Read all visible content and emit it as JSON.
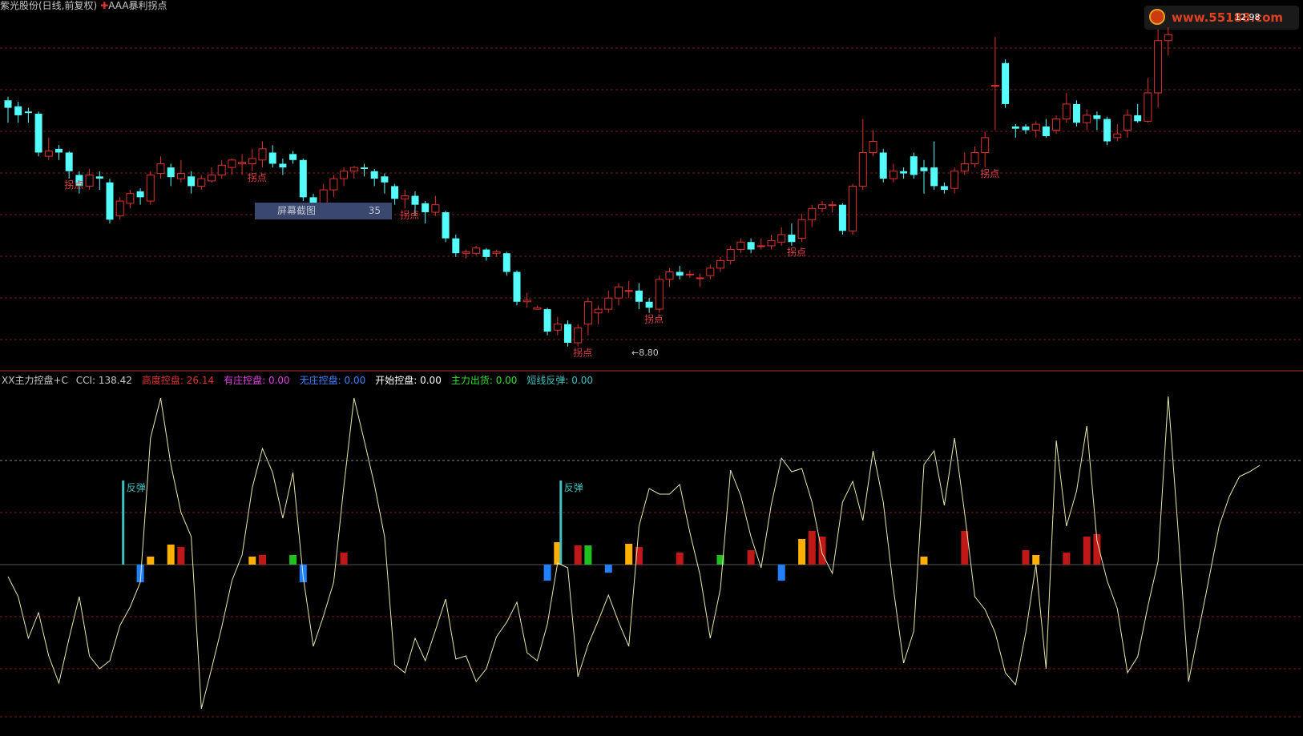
{
  "header": {
    "title": "紫光股份(日线,前复权)",
    "indicator": "AAA暴利拐点",
    "price_high": "12.98",
    "price_low": "8.80"
  },
  "watermark": {
    "text": "www.55188.com"
  },
  "tooltip": {
    "label": "屏幕截图",
    "value": "35"
  },
  "sub_header": {
    "name": "XX主力控盘+C",
    "items": [
      {
        "label": "CCI",
        "value": "138.42",
        "color": "#c8c8c8"
      },
      {
        "label": "高度控盘",
        "value": "26.14",
        "color": "#e03030"
      },
      {
        "label": "有庄控盘",
        "value": "0.00",
        "color": "#e040e0"
      },
      {
        "label": "无庄控盘",
        "value": "0.00",
        "color": "#4080ff"
      },
      {
        "label": "开始控盘",
        "value": "0.00",
        "color": "#ffffff"
      },
      {
        "label": "主力出货",
        "value": "0.00",
        "color": "#30e030"
      },
      {
        "label": "短线反弹",
        "value": "0.00",
        "color": "#40c0c0"
      }
    ]
  },
  "colors": {
    "up": "#e03030",
    "down": "#54fcfc",
    "cci_line": "#e8e8b0",
    "red_bar": "#c01818",
    "orange_bar": "#ffb000",
    "green_bar": "#20c020",
    "blue_bar": "#2080ff",
    "rebound": "#40c0c0",
    "grid": "#7a2020"
  },
  "chart_data": [
    {
      "type": "candlestick",
      "title": "紫光股份(日线,前复权)",
      "y_high_label": "12.98",
      "y_low_label": "8.80",
      "candles": [
        [
          12.0,
          11.9,
          12.05,
          11.7
        ],
        [
          11.92,
          11.8,
          11.98,
          11.7
        ],
        [
          11.85,
          11.83,
          11.9,
          11.7
        ],
        [
          11.82,
          11.3,
          11.85,
          11.25
        ],
        [
          11.25,
          11.32,
          11.5,
          11.2
        ],
        [
          11.35,
          11.3,
          11.4,
          11.2
        ],
        [
          11.3,
          11.05,
          11.32,
          10.95
        ],
        [
          11.0,
          10.85,
          11.05,
          10.75
        ],
        [
          10.85,
          11.0,
          11.08,
          10.8
        ],
        [
          10.98,
          10.95,
          11.05,
          10.8
        ],
        [
          10.9,
          10.4,
          10.95,
          10.35
        ],
        [
          10.45,
          10.65,
          10.7,
          10.4
        ],
        [
          10.62,
          10.75,
          10.8,
          10.55
        ],
        [
          10.78,
          10.7,
          10.82,
          10.6
        ],
        [
          10.65,
          11.0,
          11.05,
          10.6
        ],
        [
          11.02,
          11.15,
          11.25,
          10.95
        ],
        [
          11.1,
          10.97,
          11.15,
          10.85
        ],
        [
          10.95,
          11.02,
          11.2,
          10.9
        ],
        [
          10.98,
          10.85,
          11.05,
          10.75
        ],
        [
          10.85,
          10.95,
          11.0,
          10.8
        ],
        [
          10.92,
          11.0,
          11.1,
          10.9
        ],
        [
          11.0,
          11.13,
          11.2,
          10.95
        ],
        [
          11.1,
          11.2,
          11.22,
          11.0
        ],
        [
          11.15,
          11.17,
          11.28,
          11.0
        ],
        [
          11.15,
          11.22,
          11.35,
          11.05
        ],
        [
          11.2,
          11.35,
          11.45,
          11.1
        ],
        [
          11.3,
          11.15,
          11.4,
          11.1
        ],
        [
          11.15,
          11.1,
          11.22,
          11.0
        ],
        [
          11.28,
          11.2,
          11.32,
          11.15
        ],
        [
          11.2,
          10.7,
          11.22,
          10.65
        ],
        [
          10.7,
          10.62,
          10.75,
          10.55
        ],
        [
          10.62,
          10.8,
          10.88,
          10.55
        ],
        [
          10.8,
          10.95,
          11.0,
          10.7
        ],
        [
          10.95,
          11.05,
          11.1,
          10.85
        ],
        [
          11.05,
          11.1,
          11.12,
          10.95
        ],
        [
          11.1,
          11.08,
          11.15,
          10.98
        ],
        [
          11.05,
          10.95,
          11.08,
          10.85
        ],
        [
          10.98,
          10.9,
          11.02,
          10.75
        ],
        [
          10.85,
          10.68,
          10.88,
          10.6
        ],
        [
          10.68,
          10.72,
          10.8,
          10.55
        ],
        [
          10.72,
          10.6,
          10.78,
          10.45
        ],
        [
          10.62,
          10.5,
          10.65,
          10.35
        ],
        [
          10.5,
          10.6,
          10.72,
          10.45
        ],
        [
          10.5,
          10.15,
          10.52,
          10.1
        ],
        [
          10.15,
          9.95,
          10.2,
          9.9
        ],
        [
          9.95,
          9.97,
          10.0,
          9.88
        ],
        [
          9.95,
          10.02,
          10.05,
          9.92
        ],
        [
          10.0,
          9.9,
          10.02,
          9.85
        ],
        [
          9.95,
          9.97,
          10.0,
          9.9
        ],
        [
          9.95,
          9.7,
          9.97,
          9.65
        ],
        [
          9.7,
          9.3,
          9.72,
          9.25
        ],
        [
          9.3,
          9.32,
          9.42,
          9.22
        ],
        [
          9.2,
          9.22,
          9.25,
          9.2
        ],
        [
          9.2,
          8.9,
          9.22,
          8.85
        ],
        [
          8.92,
          9.0,
          9.1,
          8.85
        ],
        [
          9.0,
          8.75,
          9.05,
          8.7
        ],
        [
          8.75,
          8.95,
          9.0,
          8.7
        ],
        [
          9.0,
          9.3,
          9.35,
          8.85
        ],
        [
          9.15,
          9.2,
          9.25,
          9.0
        ],
        [
          9.2,
          9.35,
          9.45,
          9.15
        ],
        [
          9.35,
          9.5,
          9.55,
          9.25
        ],
        [
          9.45,
          9.45,
          9.58,
          9.35
        ],
        [
          9.45,
          9.3,
          9.55,
          9.2
        ],
        [
          9.3,
          9.22,
          9.35,
          9.15
        ],
        [
          9.2,
          9.6,
          9.65,
          9.15
        ],
        [
          9.6,
          9.7,
          9.75,
          9.5
        ],
        [
          9.7,
          9.65,
          9.78,
          9.6
        ],
        [
          9.67,
          9.67,
          9.72,
          9.62
        ],
        [
          9.62,
          9.62,
          9.68,
          9.5
        ],
        [
          9.65,
          9.75,
          9.8,
          9.6
        ],
        [
          9.75,
          9.85,
          9.9,
          9.7
        ],
        [
          9.85,
          10.0,
          10.05,
          9.8
        ],
        [
          10.0,
          10.1,
          10.15,
          9.95
        ],
        [
          10.1,
          10.0,
          10.15,
          9.95
        ],
        [
          10.05,
          10.05,
          10.15,
          10.0
        ],
        [
          10.05,
          10.12,
          10.2,
          10.0
        ],
        [
          10.1,
          10.2,
          10.3,
          10.05
        ],
        [
          10.2,
          10.1,
          10.35,
          10.05
        ],
        [
          10.15,
          10.4,
          10.48,
          10.1
        ],
        [
          10.4,
          10.55,
          10.6,
          10.3
        ],
        [
          10.55,
          10.6,
          10.65,
          10.5
        ],
        [
          10.6,
          10.6,
          10.65,
          10.5
        ],
        [
          10.6,
          10.25,
          10.62,
          10.2
        ],
        [
          10.25,
          10.85,
          10.88,
          10.2
        ],
        [
          10.85,
          11.3,
          11.75,
          10.8
        ],
        [
          11.3,
          11.45,
          11.6,
          11.25
        ],
        [
          11.3,
          10.95,
          11.35,
          10.9
        ],
        [
          10.95,
          11.05,
          11.15,
          10.9
        ],
        [
          11.05,
          11.02,
          11.1,
          10.95
        ],
        [
          11.25,
          11.0,
          11.3,
          10.95
        ],
        [
          11.1,
          11.05,
          11.2,
          10.75
        ],
        [
          11.1,
          10.85,
          11.45,
          10.8
        ],
        [
          10.85,
          10.8,
          10.9,
          10.75
        ],
        [
          10.82,
          11.05,
          11.1,
          10.75
        ],
        [
          11.05,
          11.15,
          11.3,
          11.0
        ],
        [
          11.15,
          11.3,
          11.38,
          11.1
        ],
        [
          11.3,
          11.5,
          11.58,
          11.1
        ],
        [
          12.2,
          12.2,
          12.85,
          11.6
        ],
        [
          12.5,
          11.95,
          12.55,
          11.9
        ],
        [
          11.65,
          11.62,
          11.68,
          11.5
        ],
        [
          11.65,
          11.6,
          11.68,
          11.55
        ],
        [
          11.6,
          11.68,
          11.72,
          11.5
        ],
        [
          11.65,
          11.52,
          11.75,
          11.5
        ],
        [
          11.6,
          11.75,
          11.8,
          11.55
        ],
        [
          11.75,
          11.95,
          12.1,
          11.7
        ],
        [
          11.95,
          11.7,
          12.0,
          11.65
        ],
        [
          11.7,
          11.8,
          11.88,
          11.6
        ],
        [
          11.8,
          11.75,
          11.85,
          11.6
        ],
        [
          11.75,
          11.45,
          11.78,
          11.4
        ],
        [
          11.5,
          11.55,
          11.68,
          11.45
        ],
        [
          11.6,
          11.8,
          11.88,
          11.5
        ],
        [
          11.8,
          11.72,
          11.95,
          11.7
        ],
        [
          11.72,
          12.1,
          12.3,
          11.7
        ],
        [
          12.1,
          12.8,
          12.95,
          11.9
        ],
        [
          12.8,
          12.88,
          12.98,
          12.6
        ]
      ],
      "turning_points": [
        {
          "index": 6,
          "label": "拐点"
        },
        {
          "index": 24,
          "label": "拐点"
        },
        {
          "index": 29,
          "label": "拐点"
        },
        {
          "index": 30,
          "label": "拐点"
        },
        {
          "index": 39,
          "label": "拐点"
        },
        {
          "index": 56,
          "label": "拐点"
        },
        {
          "index": 63,
          "label": "拐点"
        },
        {
          "index": 77,
          "label": "拐点"
        },
        {
          "index": 96,
          "label": "拐点"
        }
      ]
    },
    {
      "type": "combo",
      "title": "XX主力控盘+C",
      "cci_line": [
        -15,
        -40,
        -92,
        -60,
        -114,
        -148,
        -92,
        -40,
        -114,
        -130,
        -120,
        -76,
        -53,
        -22,
        158,
        208,
        125,
        65,
        35,
        -180,
        -130,
        -78,
        -20,
        12,
        96,
        145,
        115,
        58,
        115,
        -15,
        -102,
        -64,
        -22,
        98,
        208,
        155,
        100,
        35,
        -125,
        -135,
        -92,
        -120,
        -82,
        -43,
        -118,
        -114,
        -146,
        -130,
        -90,
        -72,
        -47,
        -110,
        -120,
        -74,
        2,
        -4,
        -140,
        -100,
        -70,
        -38,
        -72,
        -102,
        48,
        95,
        88,
        88,
        100,
        40,
        -13,
        -92,
        -30,
        118,
        86,
        35,
        -4,
        75,
        133,
        116,
        120,
        78,
        14,
        -11,
        78,
        104,
        55,
        142,
        78,
        -30,
        -123,
        -83,
        125,
        142,
        74,
        158,
        64,
        -40,
        -56,
        -85,
        -135,
        -150,
        -85,
        0,
        -130,
        155,
        48,
        92,
        173,
        30,
        -20,
        -55,
        -135,
        -115,
        -52,
        4,
        210,
        38,
        -146,
        -82,
        -18,
        48,
        85,
        110,
        116,
        124
      ],
      "bars": [
        {
          "index": 13,
          "value": -22,
          "color": "blue"
        },
        {
          "index": 14,
          "value": 10,
          "color": "orange"
        },
        {
          "index": 16,
          "value": 25,
          "color": "orange"
        },
        {
          "index": 17,
          "value": 22,
          "color": "red"
        },
        {
          "index": 24,
          "value": 10,
          "color": "orange"
        },
        {
          "index": 25,
          "value": 12,
          "color": "red"
        },
        {
          "index": 28,
          "value": 12,
          "color": "green"
        },
        {
          "index": 29,
          "value": -22,
          "color": "blue"
        },
        {
          "index": 33,
          "value": 15,
          "color": "red"
        },
        {
          "index": 53,
          "value": -20,
          "color": "blue"
        },
        {
          "index": 54,
          "value": 28,
          "color": "orange"
        },
        {
          "index": 56,
          "value": 24,
          "color": "red"
        },
        {
          "index": 57,
          "value": 24,
          "color": "green"
        },
        {
          "index": 59,
          "value": -10,
          "color": "blue"
        },
        {
          "index": 61,
          "value": 26,
          "color": "orange"
        },
        {
          "index": 62,
          "value": 22,
          "color": "red"
        },
        {
          "index": 66,
          "value": 15,
          "color": "red"
        },
        {
          "index": 70,
          "value": 12,
          "color": "green"
        },
        {
          "index": 73,
          "value": 18,
          "color": "red"
        },
        {
          "index": 76,
          "value": -20,
          "color": "blue"
        },
        {
          "index": 78,
          "value": 32,
          "color": "orange"
        },
        {
          "index": 79,
          "value": 42,
          "color": "red"
        },
        {
          "index": 80,
          "value": 35,
          "color": "red"
        },
        {
          "index": 90,
          "value": 10,
          "color": "orange"
        },
        {
          "index": 94,
          "value": 42,
          "color": "red"
        },
        {
          "index": 100,
          "value": 18,
          "color": "red"
        },
        {
          "index": 101,
          "value": 12,
          "color": "orange"
        },
        {
          "index": 104,
          "value": 15,
          "color": "red"
        },
        {
          "index": 106,
          "value": 35,
          "color": "red"
        },
        {
          "index": 107,
          "value": 38,
          "color": "red"
        }
      ],
      "rebound_signals": [
        {
          "index": 11,
          "label": "反弹"
        },
        {
          "index": 54,
          "label": "反弹"
        }
      ]
    }
  ]
}
